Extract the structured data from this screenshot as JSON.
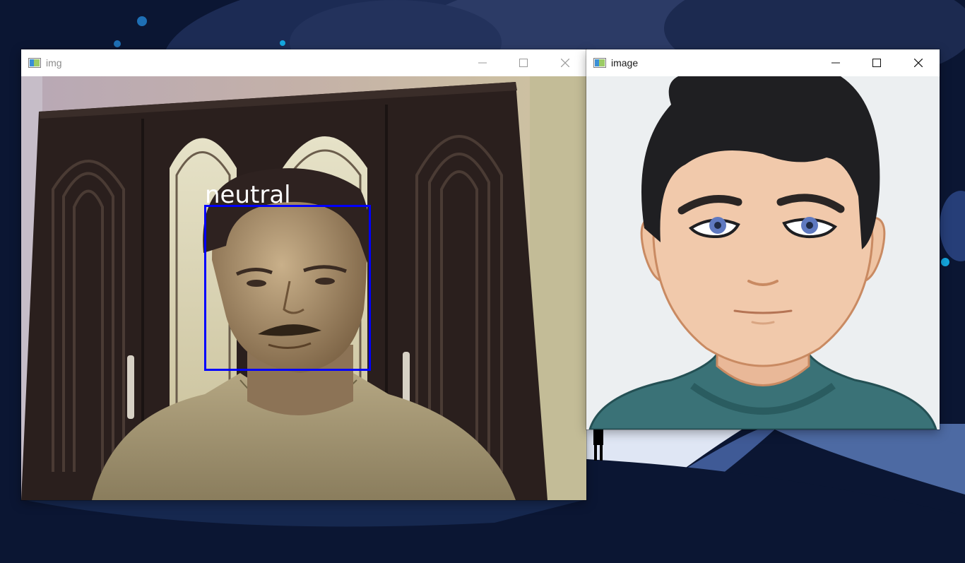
{
  "windows": {
    "webcam": {
      "title": "img",
      "emotion_label": "neutral",
      "box_color": "#0000ff"
    },
    "avatar": {
      "title": "image"
    }
  },
  "icons": {
    "app": "window-app-icon",
    "minimize": "minimize-icon",
    "maximize": "maximize-icon",
    "close": "close-icon"
  },
  "colors": {
    "desktop_bg": "#0b1633",
    "face_box": "#0000ff",
    "avatar_shirt": "#3a7277"
  }
}
